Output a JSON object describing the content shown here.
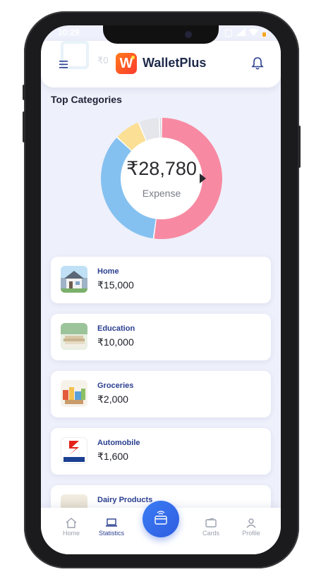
{
  "status_bar": {
    "time": "10:29"
  },
  "header": {
    "app_name": "WalletPlus",
    "logo_letter": "W",
    "ghost_text": "₹0"
  },
  "section": {
    "title": "Top Categories"
  },
  "donut": {
    "total": "₹28,780",
    "label": "Expense",
    "segments": [
      {
        "name": "Home",
        "value": 15000,
        "color": "#f78aa2"
      },
      {
        "name": "Education",
        "value": 10000,
        "color": "#85c1f0"
      },
      {
        "name": "Groceries",
        "value": 2000,
        "color": "#fbdf94"
      },
      {
        "name": "Automobile",
        "value": 1600,
        "color": "#e4e6ec"
      },
      {
        "name": "Dairy Products",
        "value": 180,
        "color": "#cfd3dc"
      }
    ]
  },
  "categories": [
    {
      "name": "Home",
      "amount": "₹15,000"
    },
    {
      "name": "Education",
      "amount": "₹10,000"
    },
    {
      "name": "Groceries",
      "amount": "₹2,000"
    },
    {
      "name": "Automobile",
      "amount": "₹1,600"
    },
    {
      "name": "Dairy Products",
      "amount": ""
    }
  ],
  "bottom_nav": {
    "home": "Home",
    "statistics": "Statistics",
    "cards": "Cards",
    "profile": "Profile"
  },
  "colors": {
    "accent": "#2a3f8f",
    "fab": "#3b7cf5",
    "background": "#eef0fb"
  }
}
